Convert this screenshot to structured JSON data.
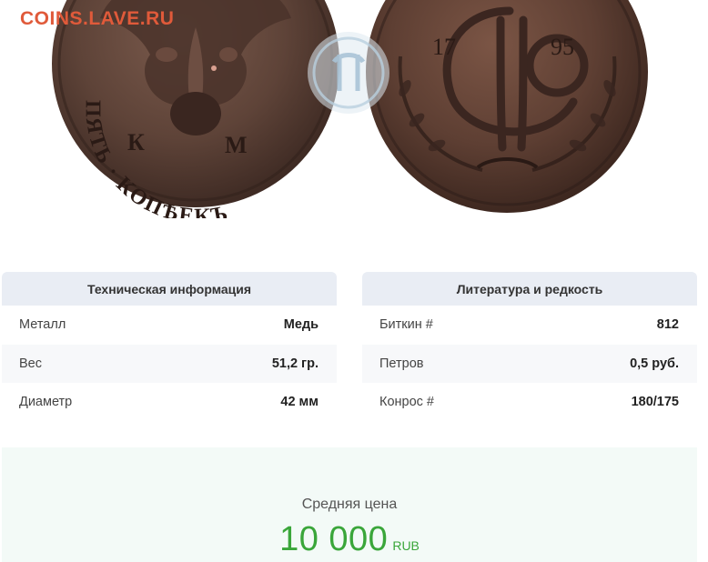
{
  "watermark": "COINS.LAVE.RU",
  "coin_images": {
    "obverse_inscription": "ПЯТЬ · КОПѢЕКЪ",
    "mint_letters": [
      "К",
      "М"
    ],
    "reverse_year_left": "17",
    "reverse_year_right": "95"
  },
  "tech": {
    "title": "Техническая информация",
    "rows": [
      {
        "label": "Металл",
        "value": "Медь"
      },
      {
        "label": "Вес",
        "value": "51,2 гр."
      },
      {
        "label": "Диаметр",
        "value": "42 мм"
      }
    ]
  },
  "lit": {
    "title": "Литература и редкость",
    "rows": [
      {
        "label": "Биткин #",
        "value": "812"
      },
      {
        "label": "Петров",
        "value": "0,5 руб."
      },
      {
        "label": "Конрос #",
        "value": "180/175"
      }
    ]
  },
  "price": {
    "label": "Средняя цена",
    "value": "10 000",
    "currency": "RUB"
  },
  "colors": {
    "watermark": "#e05a3a",
    "panel_header_bg": "#e9edf4",
    "price_bg": "#f3faf7",
    "price_green": "#3aa63a"
  }
}
